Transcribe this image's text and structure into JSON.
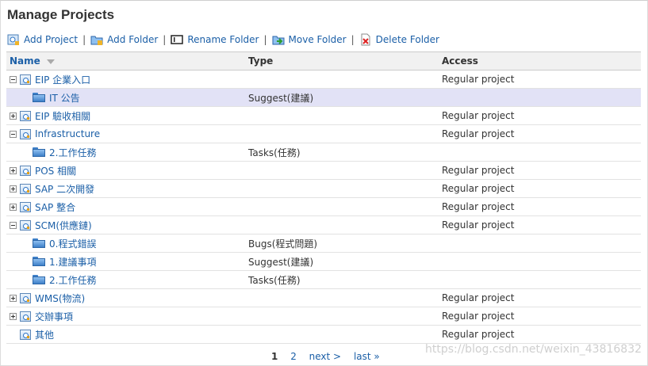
{
  "page": {
    "title": "Manage Projects"
  },
  "toolbar": {
    "add_project": "Add Project",
    "add_folder": "Add Folder",
    "rename_folder": "Rename Folder",
    "move_folder": "Move Folder",
    "delete_folder": "Delete Folder",
    "separator": "|"
  },
  "grid": {
    "columns": {
      "name": "Name",
      "type": "Type",
      "access": "Access"
    },
    "rows": [
      {
        "name": "EIP 企業入口",
        "type": "",
        "access": "Regular project"
      },
      {
        "name": "IT 公告",
        "type": "Suggest(建議)",
        "access": ""
      },
      {
        "name": "EIP 驗收相關",
        "type": "",
        "access": "Regular project"
      },
      {
        "name": "Infrastructure",
        "type": "",
        "access": "Regular project"
      },
      {
        "name": "2.工作任務",
        "type": "Tasks(任務)",
        "access": ""
      },
      {
        "name": "POS 相關",
        "type": "",
        "access": "Regular project"
      },
      {
        "name": "SAP 二次開發",
        "type": "",
        "access": "Regular project"
      },
      {
        "name": "SAP 整合",
        "type": "",
        "access": "Regular project"
      },
      {
        "name": "SCM(供應鏈)",
        "type": "",
        "access": "Regular project"
      },
      {
        "name": "0.程式錯誤",
        "type": "Bugs(程式問題)",
        "access": ""
      },
      {
        "name": "1.建議事項",
        "type": "Suggest(建議)",
        "access": ""
      },
      {
        "name": "2.工作任務",
        "type": "Tasks(任務)",
        "access": ""
      },
      {
        "name": "WMS(物流)",
        "type": "",
        "access": "Regular project"
      },
      {
        "name": "交辦事項",
        "type": "",
        "access": "Regular project"
      },
      {
        "name": "其他",
        "type": "",
        "access": "Regular project"
      }
    ]
  },
  "pager": {
    "current": "1",
    "page2": "2",
    "next": "next >",
    "last": "last »"
  },
  "watermark": "https://blog.csdn.net/weixin_43816832",
  "colors": {
    "link": "#1b5fa7",
    "selected_row": "#e2e2f6",
    "header_bg": "#f1f1f1"
  }
}
